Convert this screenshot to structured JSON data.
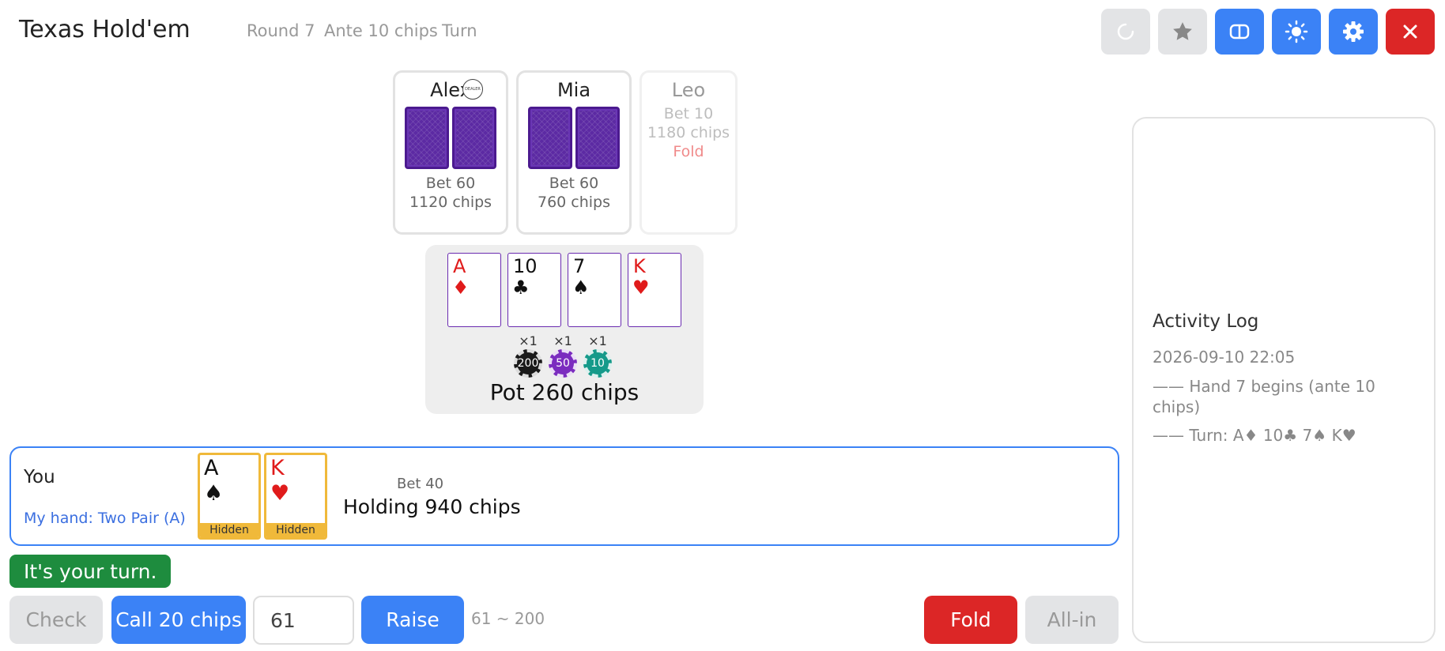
{
  "header": {
    "title": "Texas Hold'em",
    "round": "Round 7",
    "ante": "Ante 10 chips",
    "stage": "Turn"
  },
  "toolbar": {
    "buttons": [
      {
        "icon": "refresh-icon",
        "bg": "#e3e4e6",
        "fg": "#ffffff"
      },
      {
        "icon": "star-icon",
        "bg": "#e3e4e6",
        "fg": "#888888"
      },
      {
        "icon": "layout-icon",
        "bg": "#3b82f6",
        "fg": "#ffffff"
      },
      {
        "icon": "brightness-icon",
        "bg": "#3b82f6",
        "fg": "#ffffff"
      },
      {
        "icon": "gear-icon",
        "bg": "#3b82f6",
        "fg": "#ffffff"
      },
      {
        "icon": "close-icon",
        "bg": "#dc2626",
        "fg": "#ffffff"
      }
    ]
  },
  "opponents": [
    {
      "name": "Alex",
      "dealer_badge": "DEALER",
      "bet": "Bet 60",
      "chips": "1120 chips",
      "status": ""
    },
    {
      "name": "Mia",
      "bet": "Bet 60",
      "chips": "760 chips",
      "status": ""
    },
    {
      "name": "Leo",
      "bet": "Bet 10",
      "chips": "1180 chips",
      "status": "Fold"
    }
  ],
  "board": {
    "cards": [
      {
        "rank": "A",
        "suit": "♦",
        "color": "red"
      },
      {
        "rank": "10",
        "suit": "♣",
        "color": "black"
      },
      {
        "rank": "7",
        "suit": "♠",
        "color": "black"
      },
      {
        "rank": "K",
        "suit": "♥",
        "color": "red"
      }
    ],
    "chips": [
      {
        "count": "×1",
        "value": "200",
        "color": "#1a1a1a"
      },
      {
        "count": "×1",
        "value": "50",
        "color": "#7b2cbf"
      },
      {
        "count": "×1",
        "value": "10",
        "color": "#159a8a"
      }
    ],
    "pot": "Pot 260 chips"
  },
  "player": {
    "label": "You",
    "hand_desc": "My hand: Two Pair (A)",
    "cards": [
      {
        "rank": "A",
        "suit": "♠",
        "color": "black",
        "tag": "Hidden"
      },
      {
        "rank": "K",
        "suit": "♥",
        "color": "red",
        "tag": "Hidden"
      }
    ],
    "bet": "Bet 40",
    "holding": "Holding 940 chips"
  },
  "turn_banner": "It's your turn.",
  "actions": {
    "check": "Check",
    "call": "Call 20 chips",
    "raise_value": "61",
    "raise": "Raise",
    "raise_range": "61 ~ 200",
    "fold": "Fold",
    "allin": "All-in"
  },
  "log": {
    "title": "Activity Log",
    "timestamp": "2026-09-10 22:05",
    "entries": [
      "—— Hand 7 begins (ante 10 chips)",
      "—— Turn: A♦ 10♣ 7♠ K♥"
    ]
  }
}
